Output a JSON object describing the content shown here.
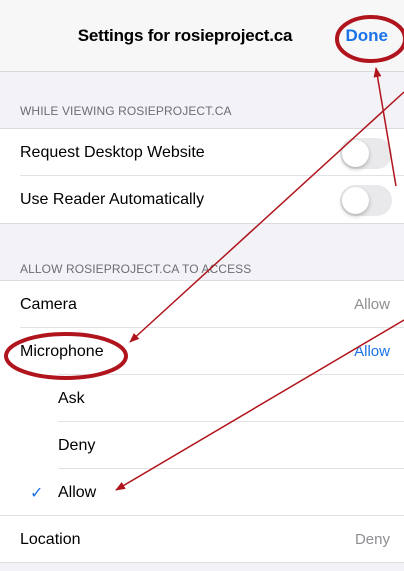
{
  "header": {
    "title": "Settings for rosieproject.ca",
    "done_label": "Done"
  },
  "viewing_section": {
    "heading": "WHILE VIEWING ROSIEPROJECT.CA",
    "items": [
      {
        "label": "Request Desktop Website",
        "toggle_on": false
      },
      {
        "label": "Use Reader Automatically",
        "toggle_on": false
      }
    ]
  },
  "access_section": {
    "heading": "ALLOW ROSIEPROJECT.CA TO ACCESS",
    "camera": {
      "label": "Camera",
      "value": "Allow"
    },
    "microphone": {
      "label": "Microphone",
      "value": "Allow"
    },
    "options": [
      "Ask",
      "Deny",
      "Allow"
    ],
    "selected_option": "Allow",
    "check_glyph": "✓",
    "location": {
      "label": "Location",
      "value": "Deny"
    }
  },
  "colors": {
    "accent": "#1a73e8",
    "annotation": "#b0141c",
    "background": "#f2f2f7"
  }
}
